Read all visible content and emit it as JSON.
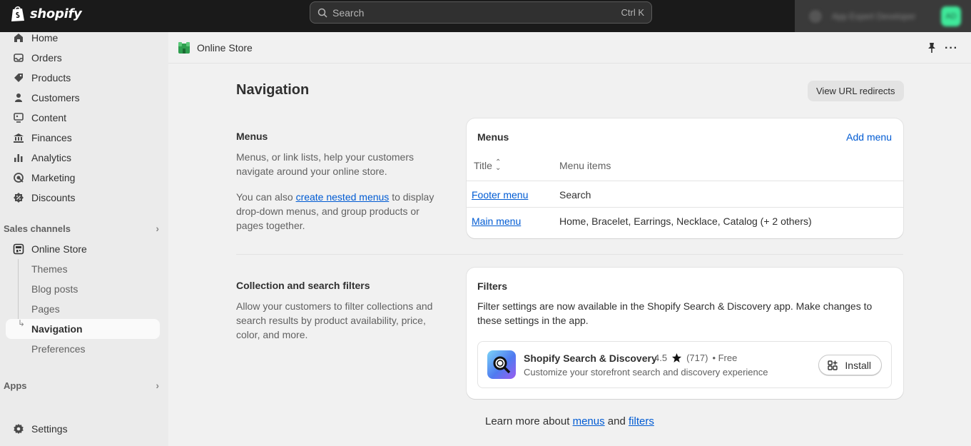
{
  "topbar": {
    "brand": "shopify",
    "search_placeholder": "Search",
    "search_shortcut": "Ctrl K",
    "store_name": "App Expert Developer",
    "avatar_initials": "AD"
  },
  "sidebar": {
    "items": [
      {
        "label": "Home",
        "icon": "home-icon"
      },
      {
        "label": "Orders",
        "icon": "inbox-icon"
      },
      {
        "label": "Products",
        "icon": "tag-icon"
      },
      {
        "label": "Customers",
        "icon": "person-icon"
      },
      {
        "label": "Content",
        "icon": "image-icon"
      },
      {
        "label": "Finances",
        "icon": "bank-icon"
      },
      {
        "label": "Analytics",
        "icon": "bar-chart-icon"
      },
      {
        "label": "Marketing",
        "icon": "target-icon"
      },
      {
        "label": "Discounts",
        "icon": "discount-icon"
      }
    ],
    "sales_channels_label": "Sales channels",
    "online_store_label": "Online Store",
    "online_store_subitems": [
      "Themes",
      "Blog posts",
      "Pages",
      "Navigation",
      "Preferences"
    ],
    "apps_label": "Apps",
    "settings_label": "Settings"
  },
  "header": {
    "breadcrumb": "Online Store"
  },
  "page": {
    "title": "Navigation",
    "view_redirects_button": "View URL redirects"
  },
  "menus_section": {
    "title": "Menus",
    "desc1": "Menus, or link lists, help your customers navigate around your online store.",
    "desc2_prefix": "You can also ",
    "desc2_link": "create nested menus",
    "desc2_suffix": " to display drop-down menus, and group products or pages together.",
    "card_title": "Menus",
    "add_menu": "Add menu",
    "col_title": "Title",
    "col_items": "Menu items",
    "rows": [
      {
        "title": "Footer menu",
        "items": "Search"
      },
      {
        "title": "Main menu",
        "items": "Home, Bracelet, Earrings, Necklace, Catalog (+ 2 others)"
      }
    ]
  },
  "filters_section": {
    "title": "Collection and search filters",
    "desc": "Allow your customers to filter collections and search results by product availability, price, color, and more.",
    "card_title": "Filters",
    "card_text": "Filter settings are now available in the Shopify Search & Discovery app. Make changes to these settings in the app.",
    "app": {
      "name": "Shopify Search & Discovery",
      "rating": "4.5",
      "reviews": "(717)",
      "price": "• Free",
      "description": "Customize your storefront search and discovery experience",
      "install_label": "Install"
    }
  },
  "footer": {
    "prefix": "Learn more about ",
    "link1": "menus",
    "middle": " and ",
    "link2": "filters"
  },
  "colors": {
    "topbar": "#1a1a1a",
    "link": "#005bd3",
    "sidebar_bg": "#ebebeb",
    "main_bg": "#f1f1f1"
  }
}
